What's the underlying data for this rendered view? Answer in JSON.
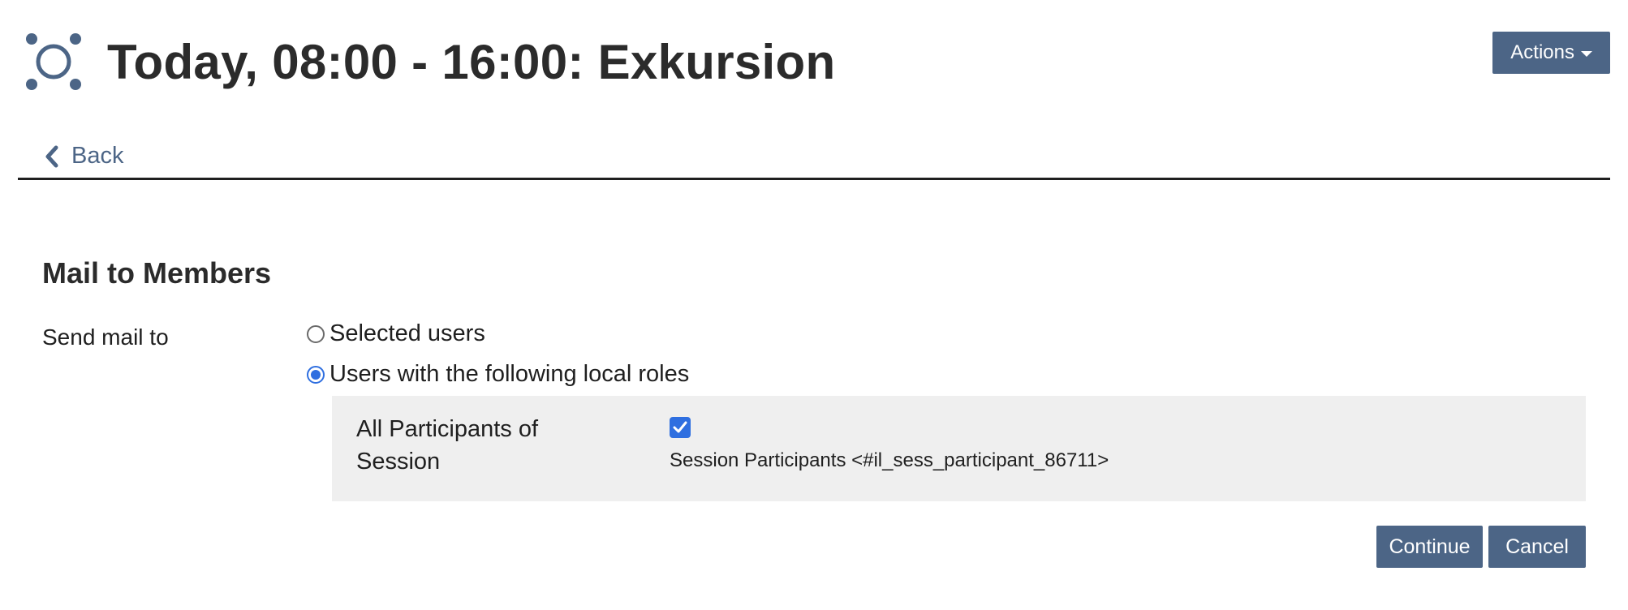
{
  "header": {
    "icon": "session-icon",
    "title": "Today, 08:00 - 16:00: Exkursion",
    "actions_label": "Actions"
  },
  "tabs": {
    "back_label": "Back",
    "back_icon": "chevron-left-icon"
  },
  "form": {
    "title": "Mail to Members",
    "send_mail_label": "Send mail to",
    "options": [
      {
        "label": "Selected users",
        "checked": false
      },
      {
        "label": "Users with the following local roles",
        "checked": true
      }
    ],
    "role": {
      "label": "All Participants of Session",
      "checked": true,
      "info": "Session Participants <#il_sess_participant_86711>"
    },
    "continue_label": "Continue",
    "cancel_label": "Cancel"
  },
  "colors": {
    "accent": "#4c6586",
    "control_blue": "#2f6fe0",
    "panel_bg": "#efefef"
  }
}
